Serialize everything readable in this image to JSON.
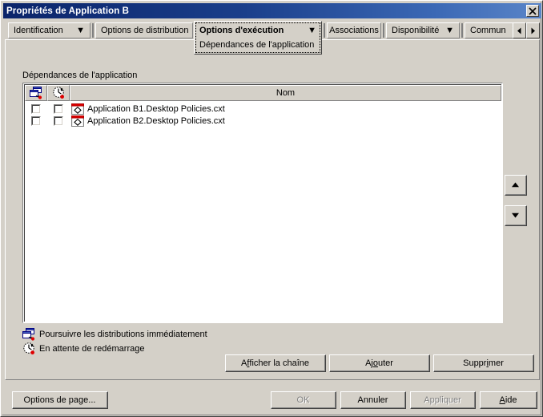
{
  "window": {
    "title": "Propriétés de Application B",
    "close_icon": "close-icon"
  },
  "tabs": [
    {
      "label": "Identification",
      "caret": "▼",
      "has_caret": true,
      "active": false
    },
    {
      "label": "Options de distribution",
      "caret": "▼",
      "has_caret": true,
      "active": false
    },
    {
      "label": "Options d'exécution",
      "caret": "▼",
      "has_caret": true,
      "active": true,
      "sublabel": "Dépendances de l'application"
    },
    {
      "label": "Associations",
      "caret": "",
      "has_caret": false,
      "active": false
    },
    {
      "label": "Disponibilité",
      "caret": "▼",
      "has_caret": true,
      "active": false
    },
    {
      "label": "Commun",
      "caret": "▼",
      "has_caret": true,
      "active": false
    }
  ],
  "tab_scroll": {
    "left_label": "◄",
    "right_label": "►",
    "left_icon": "scroll-left-icon",
    "right_icon": "scroll-right-icon"
  },
  "group": {
    "label": "Dépendances de l'application"
  },
  "list": {
    "columns": [
      {
        "id": "continue",
        "label": "",
        "icon": "continue-distribution-icon"
      },
      {
        "id": "reboot",
        "label": "",
        "icon": "wait-for-reboot-icon"
      },
      {
        "id": "name",
        "label": "Nom",
        "icon": ""
      }
    ],
    "rows": [
      {
        "continue_checked": false,
        "reboot_checked": false,
        "icon": "application-object-icon",
        "name": "Application B1.Desktop Policies.cxt"
      },
      {
        "continue_checked": false,
        "reboot_checked": false,
        "icon": "application-object-icon",
        "name": "Application B2.Desktop Policies.cxt"
      }
    ]
  },
  "reorder": {
    "up_label": "▲",
    "down_label": "▼",
    "up_icon": "move-up-icon",
    "down_icon": "move-down-icon"
  },
  "legend": [
    {
      "icon": "continue-distribution-icon",
      "text": "Poursuivre les distributions immédiatement"
    },
    {
      "icon": "wait-for-reboot-icon",
      "text": "En attente de redémarrage"
    }
  ],
  "action_buttons": [
    {
      "id": "show-chain",
      "pre": "A",
      "mnemonic": "f",
      "post": "ficher la chaîne",
      "enabled": true
    },
    {
      "id": "add",
      "pre": "Aj",
      "mnemonic": "o",
      "post": "uter",
      "enabled": true
    },
    {
      "id": "delete",
      "pre": "Suppr",
      "mnemonic": "i",
      "post": "mer",
      "enabled": true
    }
  ],
  "dialog_buttons": [
    {
      "id": "page-options",
      "pre": "Options de pa",
      "mnemonic": "g",
      "post": "e...",
      "enabled": true
    },
    {
      "id": "ok",
      "pre": "OK",
      "mnemonic": "",
      "post": "",
      "enabled": false
    },
    {
      "id": "cancel",
      "pre": "Annuler",
      "mnemonic": "",
      "post": "",
      "enabled": true
    },
    {
      "id": "apply",
      "pre": "Appliquer",
      "mnemonic": "",
      "post": "",
      "enabled": false
    },
    {
      "id": "help",
      "pre": "",
      "mnemonic": "A",
      "post": "ide",
      "enabled": true
    }
  ],
  "colors": {
    "face": "#d4d0c8",
    "title_start": "#0a246a",
    "title_end": "#5a85c8",
    "accent_red": "#e00000",
    "disabled_text": "#808080"
  }
}
